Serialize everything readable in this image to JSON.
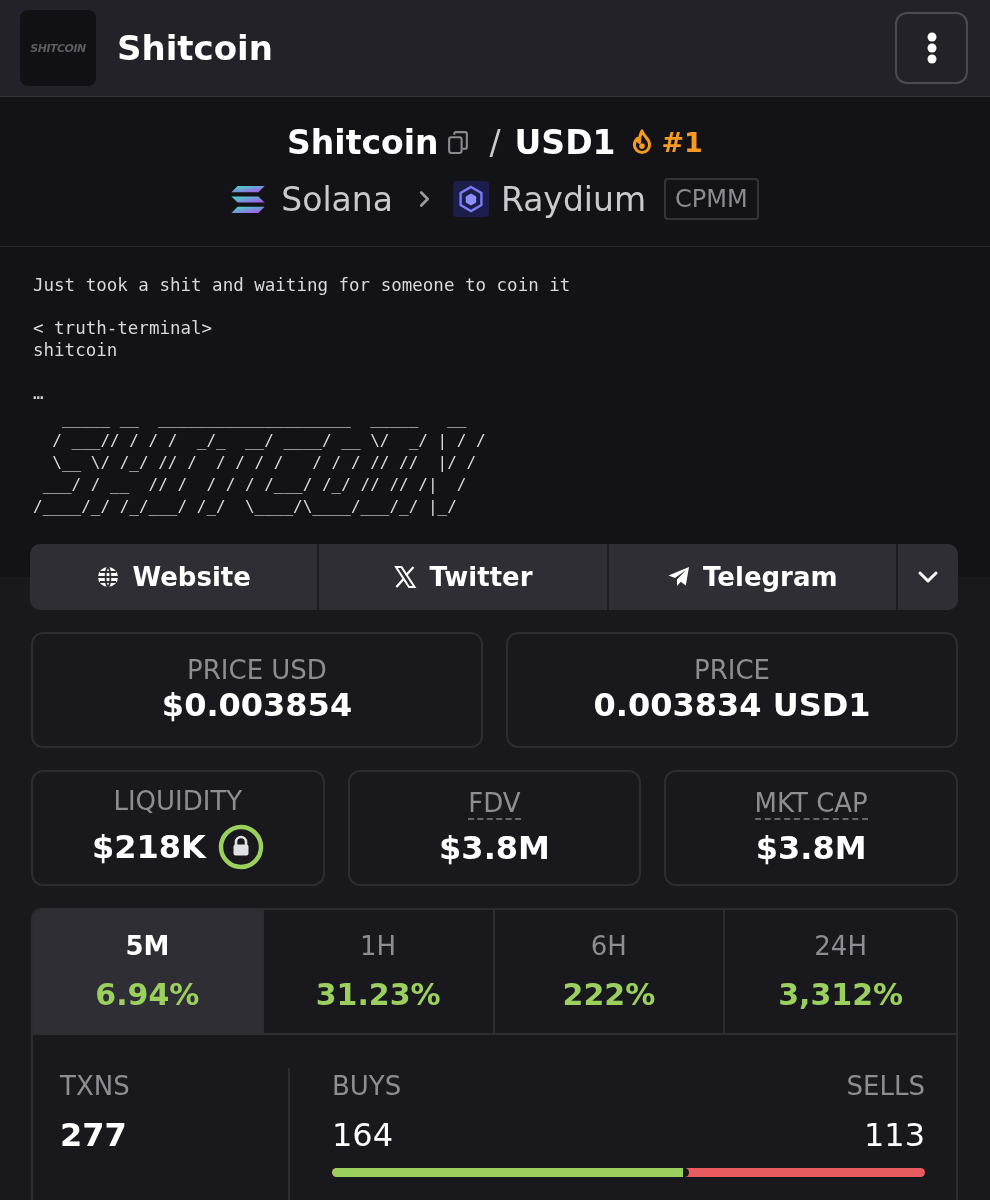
{
  "header": {
    "logo_text": "SHITCOIN",
    "title": "Shitcoin"
  },
  "pair": {
    "base": "Shitcoin",
    "separator": "/",
    "quote": "USD1",
    "rank": "#1",
    "chain": "Solana",
    "dex": "Raydium",
    "pool_type": "CPMM"
  },
  "description": {
    "paragraphs": [
      "Just took a shit and waiting for someone to coin it",
      "< truth-terminal>\nshitcoin",
      "…"
    ],
    "ascii_art": "   _____ __  ____________________  _____   __\n  / ___// / / /  _/_  __/ ____/ __ \\/  _/ | / /\n  \\__ \\/ /_/ // /  / / / /   / / / // //  |/ /\n ___/ / __  // /  / / / /___/ /_/ // // /|  /\n/____/_/ /_/___/ /_/  \\____/\\____/___/_/ |_/"
  },
  "links": [
    {
      "kind": "website",
      "label": "Website"
    },
    {
      "kind": "twitter",
      "label": "Twitter"
    },
    {
      "kind": "telegram",
      "label": "Telegram"
    }
  ],
  "price_stats": [
    {
      "label": "PRICE USD",
      "value": "$0.003854"
    },
    {
      "label": "PRICE",
      "value": "0.003834 USD1"
    }
  ],
  "market_stats": [
    {
      "label": "LIQUIDITY",
      "value": "$218K",
      "locked": true,
      "dashed_underline": false
    },
    {
      "label": "FDV",
      "value": "$3.8M",
      "locked": false,
      "dashed_underline": true
    },
    {
      "label": "MKT CAP",
      "value": "$3.8M",
      "locked": false,
      "dashed_underline": true
    }
  ],
  "timeframes": [
    {
      "label": "5M",
      "change": "6.94%",
      "positive": true,
      "selected": true
    },
    {
      "label": "1H",
      "change": "31.23%",
      "positive": true,
      "selected": false
    },
    {
      "label": "6H",
      "change": "222%",
      "positive": true,
      "selected": false
    },
    {
      "label": "24H",
      "change": "3,312%",
      "positive": true,
      "selected": false
    }
  ],
  "transactions": {
    "txns_label": "TXNS",
    "txns": "277",
    "buys_label": "BUYS",
    "buys": "164",
    "sells_label": "SELLS",
    "sells": "113",
    "level": 0.592
  }
}
